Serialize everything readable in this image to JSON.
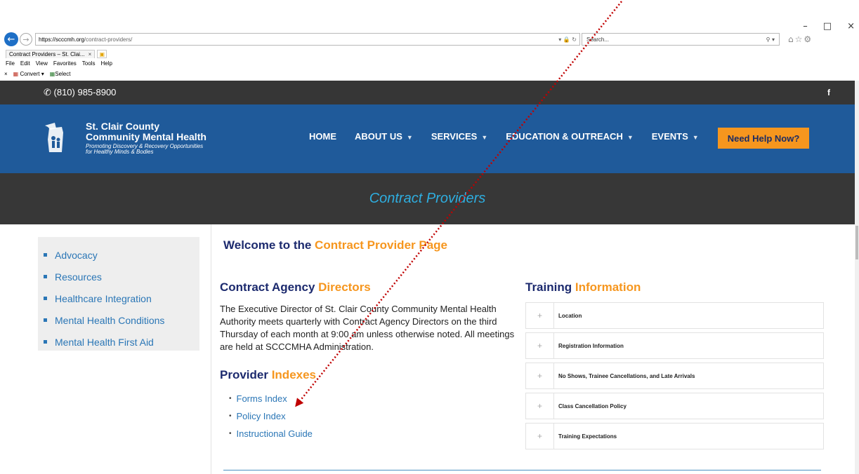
{
  "browser": {
    "url_host": "https://scccmh.org",
    "url_path": "/contract-providers/",
    "search_placeholder": "Search...",
    "tab_title": "Contract Providers – St. Clai...",
    "tab_close": "×",
    "menu": [
      "File",
      "Edit",
      "View",
      "Favorites",
      "Tools",
      "Help"
    ],
    "command_bar": {
      "close": "×",
      "convert": "Convert",
      "select": "Select"
    },
    "window_controls": [
      "–",
      "□",
      "×"
    ]
  },
  "site": {
    "phone": "(810) 985-8900",
    "facebook": "f",
    "logo": {
      "line1": "St. Clair County",
      "line2": "Community Mental Health",
      "tagline1": "Promoting Discovery & Recovery Opportunities",
      "tagline2": "for Healthy Minds & Bodies"
    },
    "nav": [
      {
        "label": "HOME",
        "dropdown": false
      },
      {
        "label": "ABOUT US",
        "dropdown": true
      },
      {
        "label": "SERVICES",
        "dropdown": true
      },
      {
        "label": "EDUCATION & OUTREACH",
        "dropdown": true
      },
      {
        "label": "EVENTS",
        "dropdown": true
      }
    ],
    "help_button": "Need Help Now?",
    "banner_title": "Contract Providers"
  },
  "sidebar": {
    "items": [
      "Advocacy",
      "Resources",
      "Healthcare Integration",
      "Mental Health Conditions",
      "Mental Health First Aid"
    ]
  },
  "main": {
    "welcome_pre": "Welcome to the ",
    "welcome_hl": "Contract Provider Page",
    "directors_title_a": "Contract Agency ",
    "directors_title_b": "Directors",
    "directors_text": "The Executive Director of St. Clair County Community Mental Health Authority meets quarterly with Contract Agency Directors on the third Thursday of each month at 9:00 am unless otherwise noted. All meetings are held at SCCCMHA Administration.",
    "indexes_title_a": "Provider ",
    "indexes_title_b": "Indexes",
    "index_links": [
      "Forms Index",
      "Policy Index",
      "Instructional Guide"
    ],
    "training_title_a": "Training ",
    "training_title_b": "Information",
    "training_items": [
      "Location",
      "Registration Information",
      "No Shows, Trainee Cancellations, and Late Arrivals",
      "Class Cancellation Policy",
      "Training Expectations"
    ]
  },
  "colors": {
    "header_blue": "#1f5a9a",
    "accent_orange": "#f6961e",
    "link_blue": "#2a76b6",
    "heading_navy": "#1c2a6e",
    "annotation_red": "#c00000"
  }
}
